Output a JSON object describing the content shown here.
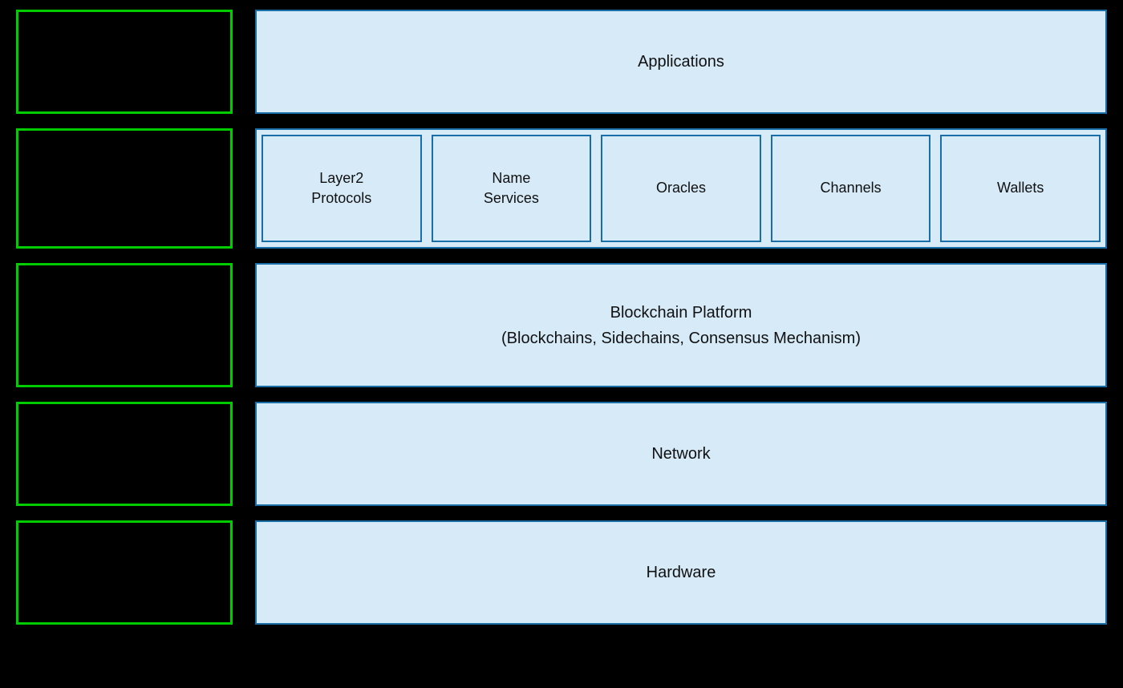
{
  "rows": [
    {
      "id": "row1",
      "right_label": "Applications",
      "type": "single"
    },
    {
      "id": "row2",
      "type": "multi",
      "cells": [
        {
          "id": "layer2",
          "label": "Layer2\nProtocols"
        },
        {
          "id": "name-services",
          "label": "Name\nServices"
        },
        {
          "id": "oracles",
          "label": "Oracles"
        },
        {
          "id": "channels",
          "label": "Channels"
        },
        {
          "id": "wallets",
          "label": "Wallets"
        }
      ]
    },
    {
      "id": "row3",
      "right_label_line1": "Blockchain Platform",
      "right_label_line2": "(Blockchains, Sidechains, Consensus Mechanism)",
      "type": "double-line"
    },
    {
      "id": "row4",
      "right_label": "Network",
      "type": "single"
    },
    {
      "id": "row5",
      "right_label": "Hardware",
      "type": "single"
    }
  ],
  "green_border_color": "#00cc00",
  "blue_bg_color": "#d6eaf8",
  "blue_border_color": "#1a6ea8"
}
